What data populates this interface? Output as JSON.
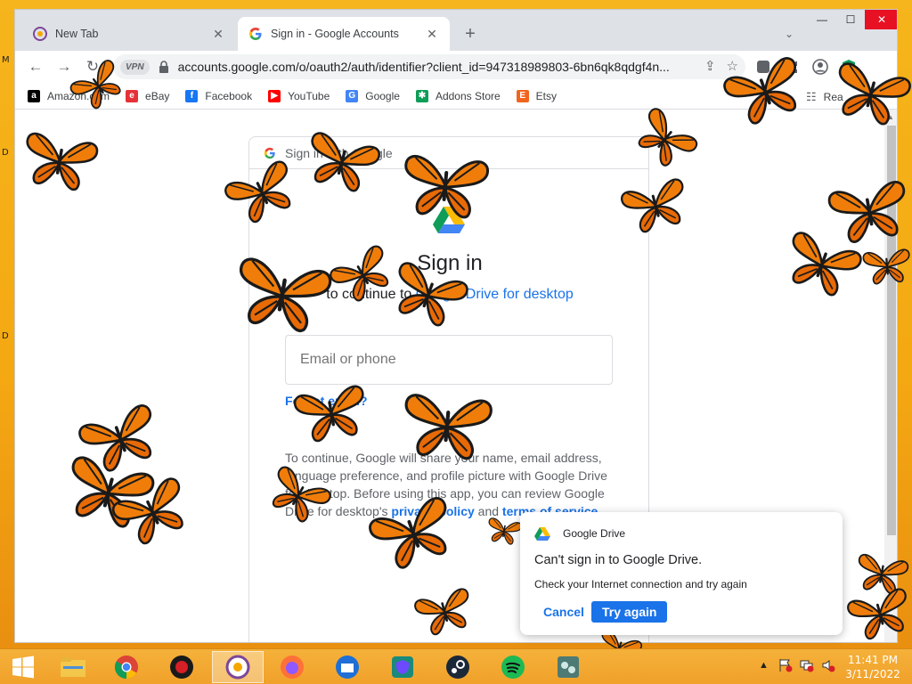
{
  "desktop": {
    "edge_letters": [
      "M",
      "D",
      "D"
    ]
  },
  "window": {
    "controls": {
      "minimize": "—",
      "maximize": "☐",
      "close": "✕"
    }
  },
  "tabs": [
    {
      "title": "New Tab",
      "icon": "tor-browser-icon"
    },
    {
      "title": "Sign in - Google Accounts",
      "icon": "google-g-icon"
    }
  ],
  "toolbar": {
    "vpn_badge": "VPN",
    "url": "accounts.google.com/o/oauth2/auth/identifier?client_id=947318989803-6bn6qk8qdgf4n..."
  },
  "bookmarks": [
    {
      "label": "Amazon.com",
      "icon": "amazon-icon",
      "color": "#000000",
      "glyph": "a"
    },
    {
      "label": "eBay",
      "icon": "ebay-icon",
      "color": "#e53238",
      "glyph": "e"
    },
    {
      "label": "Facebook",
      "icon": "facebook-icon",
      "color": "#1877f2",
      "glyph": "f"
    },
    {
      "label": "YouTube",
      "icon": "youtube-icon",
      "color": "#ff0000",
      "glyph": "▶"
    },
    {
      "label": "Google",
      "icon": "google-icon",
      "color": "#4285f4",
      "glyph": "G"
    },
    {
      "label": "Addons Store",
      "icon": "addons-store-icon",
      "color": "#0f9d58",
      "glyph": "✱"
    },
    {
      "label": "Etsy",
      "icon": "etsy-icon",
      "color": "#f1641e",
      "glyph": "E"
    }
  ],
  "reading_list": "Rea",
  "signin": {
    "header": "Sign in with Google",
    "title": "Sign in",
    "continue_prefix": "to continue to ",
    "app_name": "Google Drive for desktop",
    "email_placeholder": "Email or phone",
    "forgot_link": "Forgot email?",
    "privacy_text_1": "To continue, Google will share your name, email address, language preference, and profile picture with Google Drive for desktop. Before using this app, you can review Google Drive for desktop's ",
    "privacy_policy": "privacy policy",
    "privacy_and": " and ",
    "terms": "terms of service",
    "privacy_end": "."
  },
  "notification": {
    "app": "Google Drive",
    "title": "Can't sign in to Google Drive.",
    "body": "Check your Internet connection and try again",
    "cancel": "Cancel",
    "retry": "Try again"
  },
  "taskbar": {
    "apps": [
      "start",
      "file-explorer",
      "chrome",
      "red-app",
      "tor-browser",
      "firefox",
      "thunderbird",
      "proton-vpn",
      "steam",
      "spotify",
      "network-app"
    ],
    "clock_time": "11:41 PM",
    "clock_date": "3/11/2022"
  }
}
